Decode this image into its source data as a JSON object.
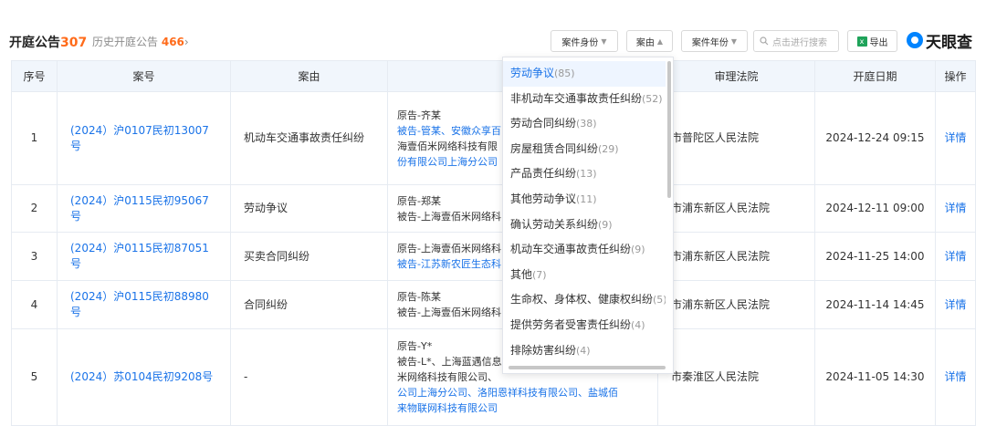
{
  "header": {
    "title": "开庭公告",
    "count": "307",
    "history_label": "历史开庭公告",
    "history_count": "466",
    "history_arrow": "›"
  },
  "filters": {
    "identity": "案件身份",
    "cause": "案由",
    "year": "案件年份",
    "search_placeholder": "点击进行搜索",
    "export": "导出",
    "brand": "天眼查"
  },
  "table": {
    "columns": [
      "序号",
      "案号",
      "案由",
      "案",
      "审理法院",
      "开庭日期",
      "操作"
    ],
    "rows": [
      {
        "no": "1",
        "case_no": "(2024）沪0107民初13007号",
        "cause": "机动车交通事故责任纠纷",
        "party_lines": [
          "原告-齐某",
          "被告-管某、安徽众享百",
          "海壹佰米网络科技有限",
          "份有限公司上海分公司"
        ],
        "court": "市普陀区人民法院",
        "date": "2024-12-24 09:15",
        "action": "详情"
      },
      {
        "no": "2",
        "case_no": "(2024）沪0115民初95067号",
        "cause": "劳动争议",
        "party_lines": [
          "原告-郑某",
          "被告-上海壹佰米网络科"
        ],
        "court": "市浦东新区人民法院",
        "date": "2024-12-11 09:00",
        "action": "详情"
      },
      {
        "no": "3",
        "case_no": "(2024）沪0115民初87051号",
        "cause": "买卖合同纠纷",
        "party_lines": [
          "原告-上海壹佰米网络科",
          "被告-江苏新农匠生态科"
        ],
        "court": "市浦东新区人民法院",
        "date": "2024-11-25 14:00",
        "action": "详情"
      },
      {
        "no": "4",
        "case_no": "(2024）沪0115民初88980号",
        "cause": "合同纠纷",
        "party_lines": [
          "原告-陈某",
          "被告-上海壹佰米网络科"
        ],
        "court": "市浦东新区人民法院",
        "date": "2024-11-14 14:45",
        "action": "详情"
      },
      {
        "no": "5",
        "case_no": "(2024）苏0104民初9208号",
        "cause": "-",
        "party_lines": [
          "原告-Y*",
          "被告-L*、上海蓝遇信息",
          "米网络科技有限公司、",
          "公司上海分公司、洛阳恩祥科技有限公司、盐城佰",
          "来物联网科技有限公司"
        ],
        "court": "市秦淮区人民法院",
        "date": "2024-11-05 14:30",
        "action": "详情"
      }
    ]
  },
  "dropdown": {
    "items": [
      {
        "label": "劳动争议",
        "count": "(85)"
      },
      {
        "label": "非机动车交通事故责任纠纷",
        "count": "(52)"
      },
      {
        "label": "劳动合同纠纷",
        "count": "(38)"
      },
      {
        "label": "房屋租赁合同纠纷",
        "count": "(29)"
      },
      {
        "label": "产品责任纠纷",
        "count": "(13)"
      },
      {
        "label": "其他劳动争议",
        "count": "(11)"
      },
      {
        "label": "确认劳动关系纠纷",
        "count": "(9)"
      },
      {
        "label": "机动车交通事故责任纠纷",
        "count": "(9)"
      },
      {
        "label": "其他",
        "count": "(7)"
      },
      {
        "label": "生命权、身体权、健康权纠纷",
        "count": "(5)"
      },
      {
        "label": "提供劳务者受害责任纠纷",
        "count": "(4)"
      },
      {
        "label": "排除妨害纠纷",
        "count": "(4)"
      }
    ]
  }
}
